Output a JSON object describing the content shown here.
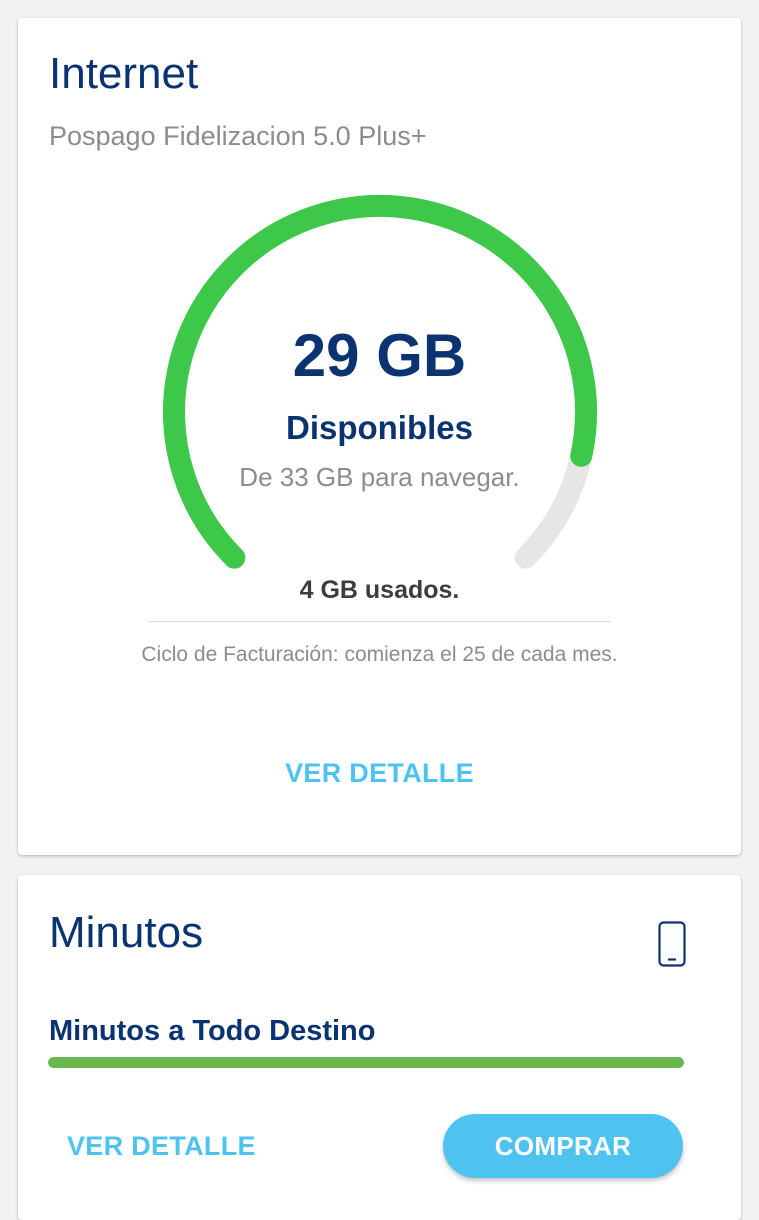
{
  "colors": {
    "primary": "#0a3371",
    "accent": "#4ec3f0",
    "gauge_available": "#3ec84a",
    "gauge_track": "#e6e6e6",
    "minutes_bar": "#6ab74f",
    "muted_text": "#8c8c8c"
  },
  "internet": {
    "title": "Internet",
    "plan": "Pospago Fidelizacion 5.0 Plus+",
    "available_amount": "29 GB",
    "available_label": "Disponibles",
    "available_sub": "De 33 GB para navegar.",
    "used": "4 GB usados.",
    "billing_cycle": "Ciclo de Facturación: comienza el 25 de cada mes.",
    "detail_label": "VER DETALLE",
    "gauge": {
      "available_gb": 29,
      "total_gb": 33
    }
  },
  "minutes": {
    "title": "Minutos",
    "device_icon": "mobile-phone-icon",
    "plan_label": "Minutos a Todo Destino",
    "bar_fill_percent": 100,
    "detail_label": "VER DETALLE",
    "buy_label": "COMPRAR"
  }
}
